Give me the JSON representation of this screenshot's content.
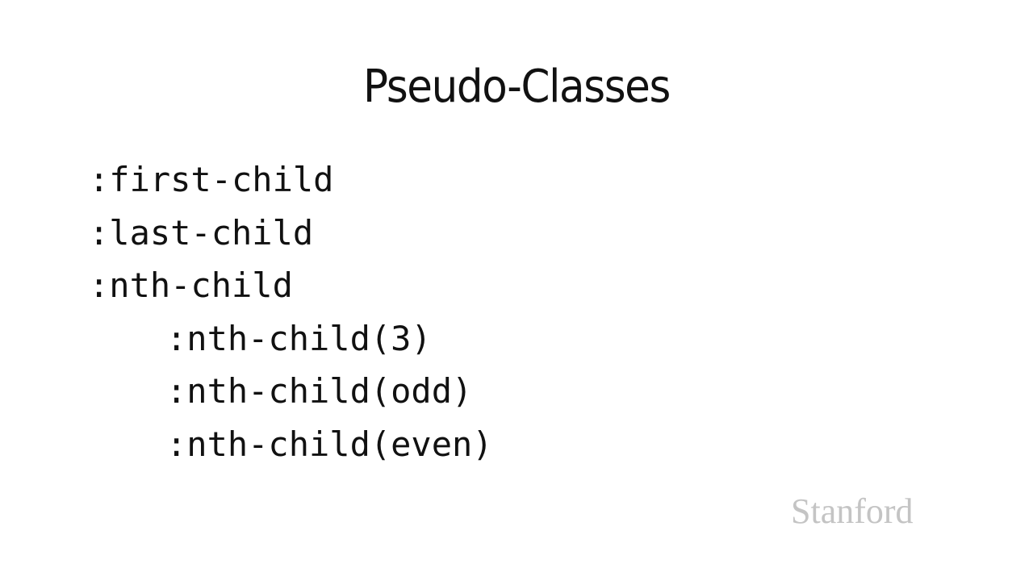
{
  "slide": {
    "title": "Pseudo-Classes",
    "lines": [
      {
        "text": ":first-child",
        "indent": false
      },
      {
        "text": ":last-child",
        "indent": false
      },
      {
        "text": ":nth-child",
        "indent": false
      },
      {
        "text": ":nth-child(3)",
        "indent": true
      },
      {
        "text": ":nth-child(odd)",
        "indent": true
      },
      {
        "text": ":nth-child(even)",
        "indent": true
      }
    ],
    "logo_text": "Stanford",
    "colors": {
      "text": "#111111",
      "logo": "#c4c4c4",
      "background": "#ffffff"
    }
  }
}
